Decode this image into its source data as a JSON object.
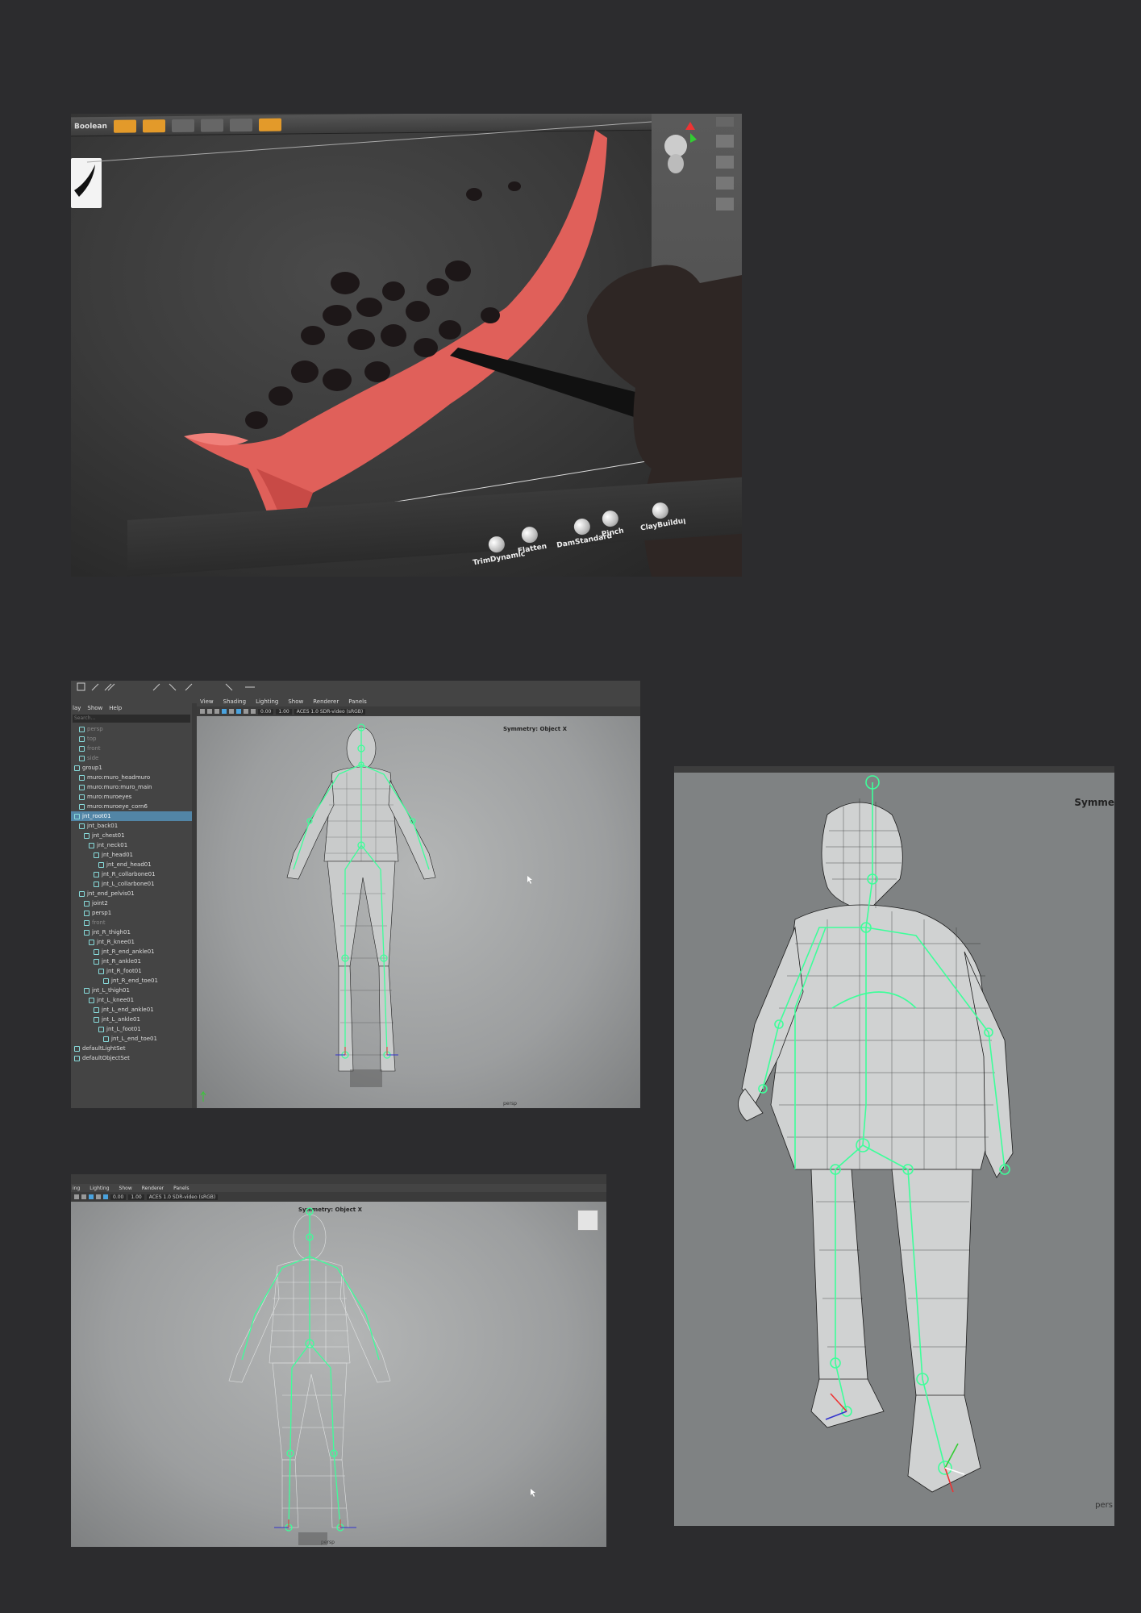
{
  "zbrush": {
    "toolbar": {
      "label": "Boolean"
    },
    "brushes": [
      "TrimDynamic",
      "Flatten",
      "DamStandard",
      "Pinch",
      "ClayBuildup"
    ],
    "colors": {
      "clay": "#e0605a",
      "dark_blobs": "#1d1718"
    }
  },
  "maya_outliner": {
    "menus": [
      "lay",
      "Show",
      "Help"
    ],
    "search_placeholder": "Search...",
    "items": [
      {
        "label": "persp",
        "state": "dim",
        "indent": 1
      },
      {
        "label": "top",
        "state": "dim",
        "indent": 1
      },
      {
        "label": "front",
        "state": "dim",
        "indent": 1
      },
      {
        "label": "side",
        "state": "dim",
        "indent": 1
      },
      {
        "label": "group1",
        "state": "normal",
        "indent": 0
      },
      {
        "label": "muro:muro_headmuro",
        "state": "normal",
        "indent": 1
      },
      {
        "label": "muro:muro:muro_main",
        "state": "normal",
        "indent": 1
      },
      {
        "label": "muro:muroeyes",
        "state": "normal",
        "indent": 1
      },
      {
        "label": "muro:muroeye_corn6",
        "state": "normal",
        "indent": 1
      },
      {
        "label": "jnt_root01",
        "state": "selected",
        "indent": 0
      },
      {
        "label": "jnt_back01",
        "state": "normal",
        "indent": 1
      },
      {
        "label": "jnt_chest01",
        "state": "normal",
        "indent": 2
      },
      {
        "label": "jnt_neck01",
        "state": "normal",
        "indent": 3
      },
      {
        "label": "jnt_head01",
        "state": "normal",
        "indent": 4
      },
      {
        "label": "jnt_end_head01",
        "state": "normal",
        "indent": 5
      },
      {
        "label": "jnt_R_collarbone01",
        "state": "normal",
        "indent": 4
      },
      {
        "label": "jnt_L_collarbone01",
        "state": "normal",
        "indent": 4
      },
      {
        "label": "jnt_end_pelvis01",
        "state": "normal",
        "indent": 1
      },
      {
        "label": "joint2",
        "state": "normal",
        "indent": 2
      },
      {
        "label": "persp1",
        "state": "normal",
        "indent": 2
      },
      {
        "label": "front",
        "state": "dim",
        "indent": 2
      },
      {
        "label": "jnt_R_thigh01",
        "state": "normal",
        "indent": 2
      },
      {
        "label": "jnt_R_knee01",
        "state": "normal",
        "indent": 3
      },
      {
        "label": "jnt_R_end_ankle01",
        "state": "normal",
        "indent": 4
      },
      {
        "label": "jnt_R_ankle01",
        "state": "normal",
        "indent": 4
      },
      {
        "label": "jnt_R_foot01",
        "state": "normal",
        "indent": 5
      },
      {
        "label": "jnt_R_end_toe01",
        "state": "normal",
        "indent": 6
      },
      {
        "label": "jnt_L_thigh01",
        "state": "normal",
        "indent": 2
      },
      {
        "label": "jnt_L_knee01",
        "state": "normal",
        "indent": 3
      },
      {
        "label": "jnt_L_end_ankle01",
        "state": "normal",
        "indent": 4
      },
      {
        "label": "jnt_L_ankle01",
        "state": "normal",
        "indent": 4
      },
      {
        "label": "jnt_L_foot01",
        "state": "normal",
        "indent": 5
      },
      {
        "label": "jnt_L_end_toe01",
        "state": "normal",
        "indent": 6
      },
      {
        "label": "defaultLightSet",
        "state": "normal",
        "indent": 0
      },
      {
        "label": "defaultObjectSet",
        "state": "normal",
        "indent": 0
      }
    ]
  },
  "maya_viewport": {
    "menus": [
      "View",
      "Shading",
      "Lighting",
      "Show",
      "Renderer",
      "Panels"
    ],
    "menus_short": [
      "ing",
      "Lighting",
      "Show",
      "Renderer",
      "Panels"
    ],
    "exposure": "0.00",
    "gamma": "1.00",
    "color_space": "ACES 1.0 SDR-video (sRGB)",
    "symmetry_label": "Symmetry: Object X",
    "symmetry_label_crop": "Symme",
    "camera": "persp",
    "camera_crop": "pers",
    "colors": {
      "joint": "#3dff9a",
      "mesh_line": "#1a1a1a",
      "mesh_fill": "#c9cbcb"
    }
  }
}
